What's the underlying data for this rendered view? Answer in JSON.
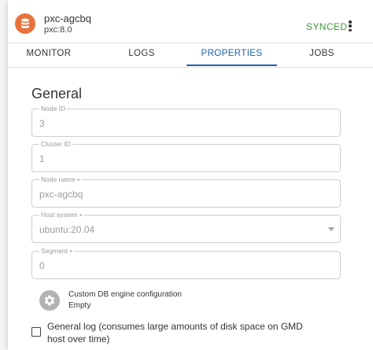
{
  "node": {
    "name": "pxc-agcbq",
    "version": "pxc:8.0",
    "status": "SYNCED"
  },
  "tabs": [
    {
      "label": "MONITOR",
      "active": false
    },
    {
      "label": "LOGS",
      "active": false
    },
    {
      "label": "PROPERTIES",
      "active": true
    },
    {
      "label": "JOBS",
      "active": false
    }
  ],
  "general": {
    "title": "General",
    "fields": {
      "node_id": {
        "label": "Node ID",
        "value": "3"
      },
      "cluster_id": {
        "label": "Cluster ID",
        "value": "1"
      },
      "node_name": {
        "label": "Node name •",
        "value": "pxc-agcbq"
      },
      "host_system": {
        "label": "Host system •",
        "value": "ubuntu:20.04"
      },
      "segment": {
        "label": "Segment •",
        "value": "0"
      }
    },
    "engine_config": {
      "title": "Custom DB engine configuration",
      "value": "Empty"
    },
    "general_log": {
      "label": "General log (consumes large amounts of disk space on GMD host over time)",
      "checked": false
    }
  },
  "colors": {
    "brand_orange": "#e8733a",
    "synced_green": "#3b9a3b",
    "active_tab_blue": "#1e62a6"
  },
  "icons": [
    "database-icon",
    "more-vert-icon",
    "gear-icon",
    "dropdown-arrow-icon"
  ]
}
